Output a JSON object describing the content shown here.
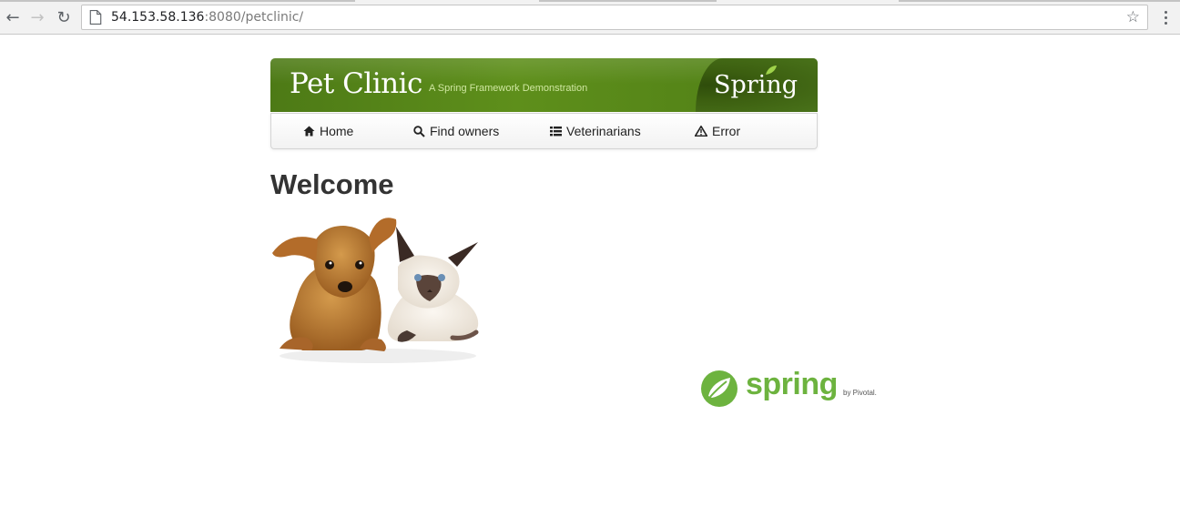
{
  "browser": {
    "url_host": "54.153.58.136",
    "url_rest": ":8080/petclinic/",
    "back_icon": "back-arrow-icon",
    "forward_icon": "forward-arrow-icon",
    "reload_icon": "reload-icon",
    "bookmark_icon": "star-icon",
    "menu_icon": "more-vert-icon"
  },
  "header": {
    "title": "Pet Clinic",
    "tagline": "A Spring Framework Demonstration",
    "spring_brand": "Spring",
    "banner_color": "#5a8a1b"
  },
  "nav": {
    "items": [
      {
        "label": "Home",
        "icon": "home-icon"
      },
      {
        "label": "Find owners",
        "icon": "search-icon"
      },
      {
        "label": "Veterinarians",
        "icon": "list-icon"
      },
      {
        "label": "Error",
        "icon": "warning-icon"
      }
    ]
  },
  "main": {
    "heading": "Welcome",
    "image": "pets-image"
  },
  "footer": {
    "logo_text": "spring",
    "logo_by": "by Pivotal.",
    "logo_color": "#6db33f"
  }
}
